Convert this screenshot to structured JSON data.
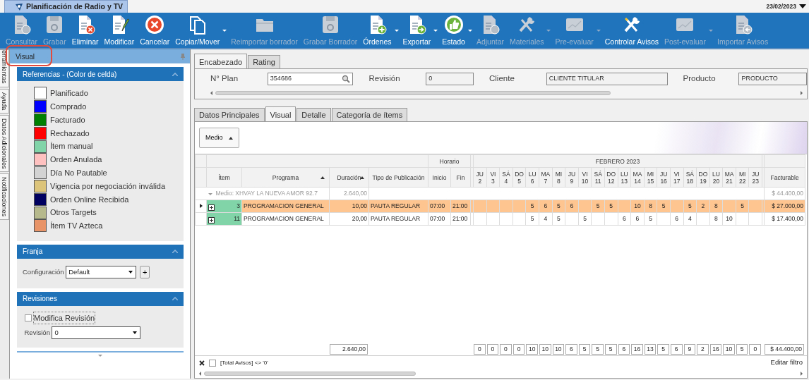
{
  "app_tab": {
    "title": "Planificación de Radio y TV"
  },
  "date": "23/02/2023",
  "toolbar": [
    {
      "label": "Consultar",
      "kind": "doc-question",
      "disabled": true,
      "dropdown": false
    },
    {
      "label": "Grabar",
      "kind": "disk",
      "disabled": true,
      "dropdown": false
    },
    {
      "label": "Eliminar",
      "kind": "doc-x",
      "disabled": false,
      "dropdown": false
    },
    {
      "label": "Modificar",
      "kind": "doc-pencil",
      "disabled": false,
      "dropdown": false
    },
    {
      "label": "Cancelar",
      "kind": "x-circle",
      "disabled": false,
      "dropdown": false
    },
    {
      "label": "Copiar/Mover",
      "kind": "copy",
      "disabled": false,
      "dropdown": true
    },
    {
      "label": "Reimportar borrador",
      "kind": "folder",
      "disabled": true,
      "dropdown": false
    },
    {
      "label": "Grabar Borrador",
      "kind": "disk",
      "disabled": true,
      "dropdown": false
    },
    {
      "label": "Órdenes",
      "kind": "doc-plus",
      "disabled": false,
      "dropdown": true
    },
    {
      "label": "Exportar",
      "kind": "doc-arrow",
      "disabled": false,
      "dropdown": true
    },
    {
      "label": "Estado",
      "kind": "thumb",
      "disabled": false,
      "dropdown": true
    },
    {
      "label": "Adjuntar",
      "kind": "doc-clip",
      "disabled": true,
      "dropdown": false
    },
    {
      "label": "Materiales",
      "kind": "tools",
      "disabled": true,
      "dropdown": true
    },
    {
      "label": "Pre-evaluar",
      "kind": "chart",
      "disabled": true,
      "dropdown": true
    },
    {
      "label": "Controlar Avisos",
      "kind": "tools",
      "disabled": false,
      "dropdown": false
    },
    {
      "label": "Post-evaluar",
      "kind": "chart",
      "disabled": true,
      "dropdown": true
    },
    {
      "label": "Importar Avisos",
      "kind": "doc-back",
      "disabled": true,
      "dropdown": false
    }
  ],
  "side_tabs": [
    "erramientas",
    "Ayuda",
    "Datos Adicionales",
    "Notificaciones"
  ],
  "visual_panel": {
    "title": "Visual"
  },
  "references": {
    "title": "Referencias - (Color de celda)",
    "items": [
      {
        "label": "Planificado",
        "color": "#ffffff"
      },
      {
        "label": "Comprado",
        "color": "#0000ff"
      },
      {
        "label": "Facturado",
        "color": "#008000"
      },
      {
        "label": "Rechazado",
        "color": "#ff0000"
      },
      {
        "label": "Ítem manual",
        "color": "#80d4a8"
      },
      {
        "label": "Orden Anulada",
        "color": "#ffc0c0"
      },
      {
        "label": "Día No Pautable",
        "color": "#d3d3d3"
      },
      {
        "label": "Vigencia por negociación inválida",
        "color": "#dcc57a"
      },
      {
        "label": "Orden Online Recibida",
        "color": "#000060"
      },
      {
        "label": "Otros Targets",
        "color": "#b5b98c"
      },
      {
        "label": "Ítem TV Azteca",
        "color": "#e89468"
      }
    ]
  },
  "franja": {
    "title": "Franja",
    "label": "Configuración",
    "value": "Default",
    "add": "+"
  },
  "revisiones": {
    "title": "Revisiones",
    "checkbox": {
      "label": "Modifica Revisión",
      "checked": false
    },
    "label": "Revisión",
    "value": "0"
  },
  "header_tabs": [
    {
      "label": "Encabezado",
      "selected": true
    },
    {
      "label": "Rating",
      "selected": false
    }
  ],
  "header_fields": [
    {
      "label": "N° Plan",
      "value": "354686",
      "kind": "search"
    },
    {
      "label": "Revisión",
      "value": "0",
      "kind": "readonly"
    },
    {
      "label": "Cliente",
      "value": "CLIENTE TITULAR",
      "kind": "readonly"
    },
    {
      "label": "Producto",
      "value": "PRODUCTO",
      "kind": "readonly"
    }
  ],
  "detail_tabs": [
    {
      "label": "Datos Principales",
      "selected": false
    },
    {
      "label": "Visual",
      "selected": true
    },
    {
      "label": "Detalle",
      "selected": false
    },
    {
      "label": "Categoría de ítems",
      "selected": false
    }
  ],
  "group_button": {
    "label": "Medio"
  },
  "grid": {
    "horario": "Horario",
    "month": "FEBRERO 2023",
    "columns": [
      "Ítem",
      "Programa",
      "Duración",
      "Tipo de Publicación",
      "Inicio",
      "Fin"
    ],
    "facturable": "Facturable",
    "days": [
      [
        "JU",
        "2"
      ],
      [
        "VI",
        "3"
      ],
      [
        "SÁ",
        "4"
      ],
      [
        "DO",
        "5"
      ],
      [
        "LU",
        "6"
      ],
      [
        "MA",
        "7"
      ],
      [
        "MI",
        "8"
      ],
      [
        "JU",
        "9"
      ],
      [
        "VI",
        "10"
      ],
      [
        "SÁ",
        "11"
      ],
      [
        "DO",
        "12"
      ],
      [
        "LU",
        "13"
      ],
      [
        "MA",
        "14"
      ],
      [
        "MI",
        "15"
      ],
      [
        "JU",
        "16"
      ],
      [
        "VI",
        "17"
      ],
      [
        "SÁ",
        "18"
      ],
      [
        "DO",
        "19"
      ],
      [
        "LU",
        "20"
      ],
      [
        "MA",
        "21"
      ],
      [
        "MI",
        "22"
      ],
      [
        "JU",
        "23"
      ]
    ],
    "group": {
      "label": "Medio: XHVAY LA NUEVA AMOR 92.7",
      "duration": "2.640,00",
      "total": "$ 44.400,00",
      "expanded": true
    },
    "rows": [
      {
        "selected": true,
        "item": "3",
        "programa": "PROGRAMACION GENERAL",
        "duracion": "10,00",
        "tipo": "PAUTA REGULAR",
        "inicio": "07:00",
        "fin": "21:00",
        "total": "$ 27.000,00",
        "values": [
          {
            "kind": "empty"
          },
          {
            "kind": "empty"
          },
          {
            "kind": "empty"
          },
          {
            "kind": "empty"
          },
          {
            "kind": "count",
            "value": "5"
          },
          {
            "kind": "count",
            "value": "6"
          },
          {
            "kind": "count",
            "value": "5"
          },
          {
            "kind": "count",
            "value": "6"
          },
          {
            "kind": "empty"
          },
          {
            "kind": "count",
            "value": "5"
          },
          {
            "kind": "count",
            "value": "5"
          },
          {
            "kind": "empty"
          },
          {
            "kind": "count",
            "value": "10"
          },
          {
            "kind": "count",
            "value": "8"
          },
          {
            "kind": "count",
            "value": "5"
          },
          {
            "kind": "empty"
          },
          {
            "kind": "count",
            "value": "5"
          },
          {
            "kind": "count",
            "value": "2"
          },
          {
            "kind": "count",
            "value": "8"
          },
          {
            "kind": "empty"
          },
          {
            "kind": "count",
            "value": "5"
          },
          {
            "kind": "empty"
          }
        ]
      },
      {
        "selected": false,
        "item": "11",
        "programa": "PROGRAMACION GENERAL",
        "duracion": "20,00",
        "tipo": "PAUTA REGULAR",
        "inicio": "07:00",
        "fin": "21:00",
        "total": "$ 17.400,00",
        "values": [
          {
            "kind": "empty"
          },
          {
            "kind": "empty"
          },
          {
            "kind": "empty"
          },
          {
            "kind": "empty"
          },
          {
            "kind": "count",
            "value": "5"
          },
          {
            "kind": "count",
            "value": "4"
          },
          {
            "kind": "count",
            "value": "5"
          },
          {
            "kind": "empty"
          },
          {
            "kind": "count",
            "value": "5"
          },
          {
            "kind": "empty"
          },
          {
            "kind": "empty"
          },
          {
            "kind": "count",
            "value": "6"
          },
          {
            "kind": "count",
            "value": "6"
          },
          {
            "kind": "count",
            "value": "5"
          },
          {
            "kind": "empty"
          },
          {
            "kind": "count",
            "value": "6"
          },
          {
            "kind": "count",
            "value": "4"
          },
          {
            "kind": "empty"
          },
          {
            "kind": "count",
            "value": "8"
          },
          {
            "kind": "count",
            "value": "10"
          },
          {
            "kind": "empty"
          },
          {
            "kind": "empty"
          }
        ]
      }
    ],
    "footer": {
      "duration": "2.640,00",
      "total": "$ 44.400,00",
      "values": [
        "0",
        "0",
        "0",
        "0",
        "10",
        "10",
        "10",
        "6",
        "5",
        "5",
        "5",
        "6",
        "16",
        "13",
        "5",
        "6",
        "9",
        "2",
        "16",
        "10",
        "5",
        "0"
      ]
    }
  },
  "filter": {
    "text": "[Total Avisos] <> '0'",
    "checked": false,
    "edit": "Editar filtro"
  }
}
